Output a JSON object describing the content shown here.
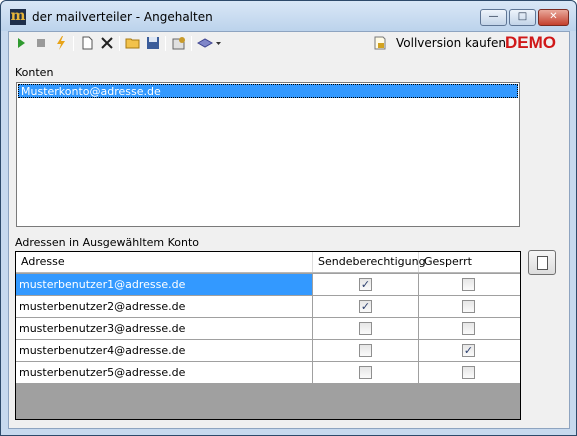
{
  "window": {
    "title": "der mailverteiler - Angehalten",
    "app_icon_glyph": "m",
    "buttons": {
      "minimize": "—",
      "maximize": "□",
      "close": "✕"
    }
  },
  "toolbar": {
    "icons": [
      "play-icon",
      "stop-icon",
      "lightning-icon",
      "new-document-icon",
      "delete-icon",
      "open-folder-icon",
      "save-icon",
      "settings-icon",
      "layers-dropdown-icon"
    ],
    "vollversion_label": "Vollversion kaufen",
    "demo_label": "DEMO"
  },
  "konten": {
    "label": "Konten",
    "items": [
      "Musterkonto@adresse.de"
    ]
  },
  "adressen": {
    "label": "Adressen in Ausgewähltem Konto",
    "columns": [
      "Adresse",
      "Sendeberechtigung",
      "Gesperrt"
    ],
    "rows": [
      {
        "adresse": "musterbenutzer1@adresse.de",
        "sende": true,
        "gesperrt": false
      },
      {
        "adresse": "musterbenutzer2@adresse.de",
        "sende": true,
        "gesperrt": false
      },
      {
        "adresse": "musterbenutzer3@adresse.de",
        "sende": false,
        "gesperrt": false
      },
      {
        "adresse": "musterbenutzer4@adresse.de",
        "sende": false,
        "gesperrt": true
      },
      {
        "adresse": "musterbenutzer5@adresse.de",
        "sende": false,
        "gesperrt": false
      }
    ]
  },
  "colors": {
    "selection": "#3399ff",
    "demo": "#d01818"
  }
}
